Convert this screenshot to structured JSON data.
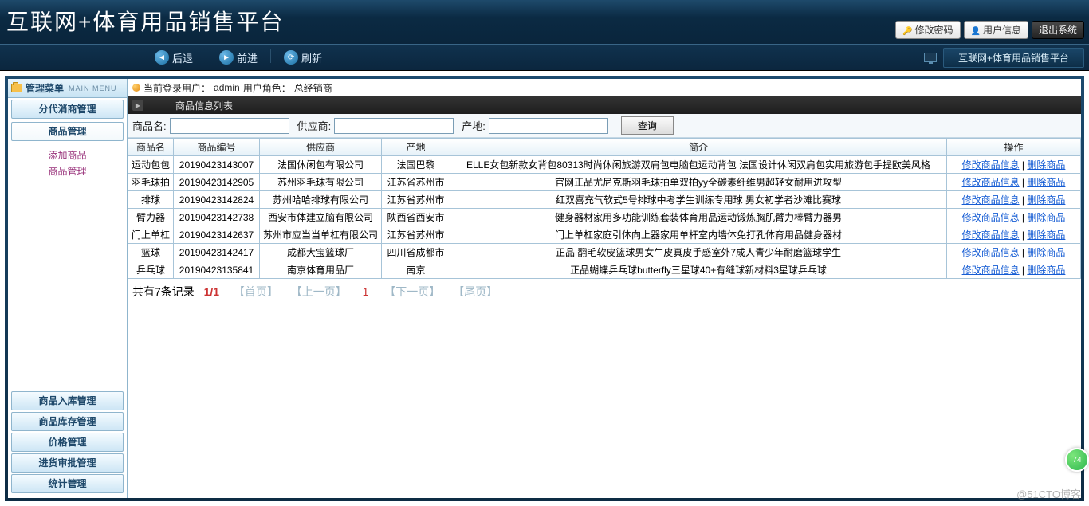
{
  "banner": {
    "title": "互联网+体育用品销售平台",
    "change_pw": "修改密码",
    "user_info": "用户信息",
    "logout": "退出系统"
  },
  "nav": {
    "back": "后退",
    "forward": "前进",
    "refresh": "刷新",
    "right_module": "互联网+体育用品销售平台"
  },
  "sidebar": {
    "head": "管理菜单",
    "head_sub": "MAIN MENU",
    "items": [
      "分代消商管理",
      "商品管理",
      "商品入库管理",
      "商品库存管理",
      "价格管理",
      "进货审批管理",
      "统计管理"
    ],
    "submenu": [
      "添加商品",
      "商品管理"
    ]
  },
  "userbar": {
    "prefix": "当前登录用户：",
    "user": "admin",
    "role_prefix": " 用户角色：",
    "role": "总经销商"
  },
  "panel": {
    "title": "商品信息列表"
  },
  "search": {
    "name_label": "商品名:",
    "supplier_label": "供应商:",
    "place_label": "产地:",
    "query": "查询"
  },
  "table": {
    "headers": [
      "商品名",
      "商品编号",
      "供应商",
      "产地",
      "简介",
      "操作"
    ],
    "op_edit": "修改商品信息",
    "op_del": "删除商品",
    "rows": [
      {
        "name": "运动包包",
        "code": "20190423143007",
        "supplier": "法国休闲包有限公司",
        "place": "法国巴黎",
        "intro": "ELLE女包新款女背包80313时尚休闲旅游双肩包电脑包运动背包 法国设计休闲双肩包实用旅游包手提欧美风格"
      },
      {
        "name": "羽毛球拍",
        "code": "20190423142905",
        "supplier": "苏州羽毛球有限公司",
        "place": "江苏省苏州市",
        "intro": "官网正品尤尼克斯羽毛球拍单双拍yy全碳素纤维男超轻女耐用进攻型"
      },
      {
        "name": "排球",
        "code": "20190423142824",
        "supplier": "苏州哈哈排球有限公司",
        "place": "江苏省苏州市",
        "intro": "红双喜充气软式5号排球中考学生训练专用球 男女初学者沙滩比赛球"
      },
      {
        "name": "臂力器",
        "code": "20190423142738",
        "supplier": "西安市体建立脑有限公司",
        "place": "陕西省西安市",
        "intro": "健身器材家用多功能训练套装体育用品运动锻炼胸肌臂力棒臂力器男"
      },
      {
        "name": "门上单杠",
        "code": "20190423142637",
        "supplier": "苏州市应当当单杠有限公司",
        "place": "江苏省苏州市",
        "intro": "门上单杠家庭引体向上器家用单杆室内墙体免打孔体育用品健身器材"
      },
      {
        "name": "篮球",
        "code": "20190423142417",
        "supplier": "成都大宝篮球厂",
        "place": "四川省成都市",
        "intro": "正品 翻毛软皮篮球男女牛皮真皮手感室外7成人青少年耐磨篮球学生"
      },
      {
        "name": "乒乓球",
        "code": "20190423135841",
        "supplier": "南京体育用品厂",
        "place": "南京",
        "intro": "正品蝴蝶乒乓球butterfly三星球40+有缝球新材料3星球乒乓球"
      }
    ]
  },
  "pager": {
    "total_prefix": "共有",
    "total_count": "7",
    "total_suffix": "条记录",
    "page_pos": "1/1",
    "first": "【首页】",
    "prev": "【上一页】",
    "current": "1",
    "next": "【下一页】",
    "last": "【尾页】"
  },
  "watermark": "@51CTO博客",
  "badge": "74"
}
